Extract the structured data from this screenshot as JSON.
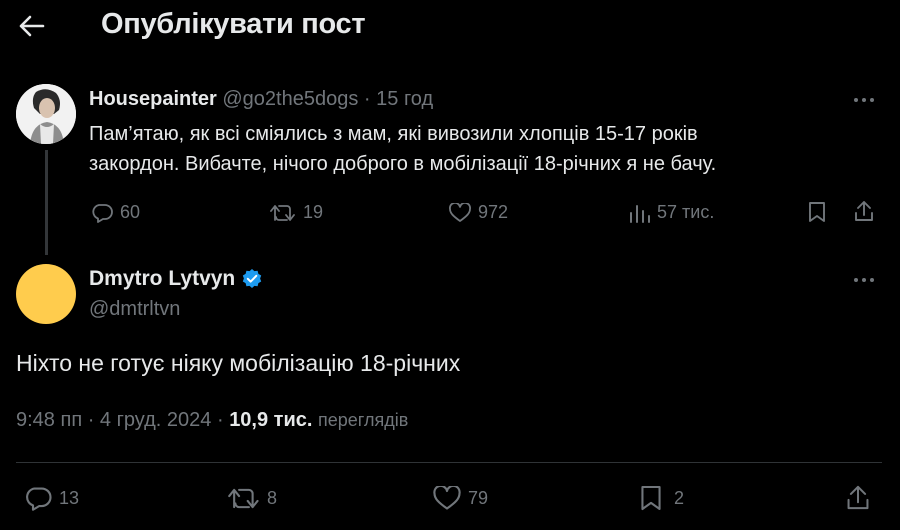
{
  "header": {
    "title": "Опублікувати пост"
  },
  "reply_tweet": {
    "name": "Housepainter",
    "handle": "@go2the5dogs",
    "separator": "·",
    "time": "15 год",
    "text_line1": "Пам’ятаю, як всі сміялись з мам, які вивозили хлопців 15-17 років",
    "text_line2": "закордон. Вибачте, нічого доброго в мобілізації 18-річних я не бачу.",
    "replies": "60",
    "reposts": "19",
    "likes": "972",
    "views": "57 тис."
  },
  "main_tweet": {
    "name": "Dmytro Lytvyn",
    "handle": "@dmtrltvn",
    "text": "Ніхто не готує ніяку мобілізацію 18-річних",
    "time": "9:48 пп · 4 груд. 2024 · ",
    "views_count": "10,9 тис.",
    "views_label": "переглядів",
    "replies": "13",
    "reposts": "8",
    "likes": "79",
    "bookmarks": "2"
  },
  "colors": {
    "background": "#000000",
    "text": "#e7e9ea",
    "muted": "#71767b",
    "verified": "#1d9bf0",
    "avatar": "#ffcc4d"
  }
}
